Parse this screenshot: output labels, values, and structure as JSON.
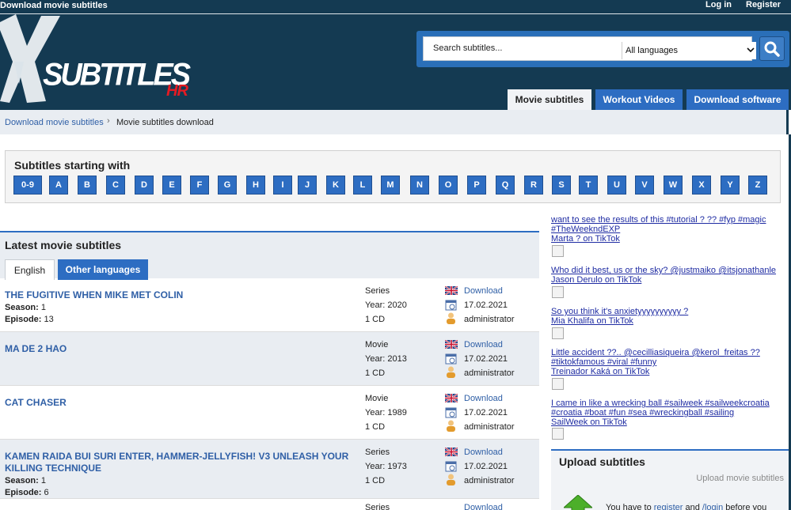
{
  "header": {
    "site_title": "Download movie subtitles",
    "login": "Log in",
    "register": "Register",
    "logo_text": "SUBTITLES",
    "logo_suffix": "HR",
    "search": {
      "placeholder": "Search subtitles...",
      "language": "All languages"
    },
    "tabs": [
      "Movie subtitles",
      "Workout Videos",
      "Download software"
    ]
  },
  "breadcrumb": {
    "link": "Download movie subtitles",
    "current": "Movie subtitles download"
  },
  "alphabet": {
    "title": "Subtitles starting with",
    "letters": [
      "0-9",
      "A",
      "B",
      "C",
      "D",
      "E",
      "F",
      "G",
      "H",
      "I",
      "J",
      "K",
      "L",
      "M",
      "N",
      "O",
      "P",
      "Q",
      "R",
      "S",
      "T",
      "U",
      "V",
      "W",
      "X",
      "Y",
      "Z"
    ]
  },
  "latest": {
    "title": "Latest movie subtitles",
    "tabs": [
      "English",
      "Other languages"
    ],
    "rows": [
      {
        "title": "THE FUGITIVE WHEN MIKE MET COLIN",
        "season": "1",
        "episode": "13",
        "type": "Series",
        "year": "Year: 2020",
        "cd": "1 CD",
        "download": "Download",
        "date": "17.02.2021",
        "user": "administrator"
      },
      {
        "title": "MA DE 2 HAO",
        "type": "Movie",
        "year": "Year: 2013",
        "cd": "1 CD",
        "download": "Download",
        "date": "17.02.2021",
        "user": "administrator"
      },
      {
        "title": "CAT CHASER",
        "type": "Movie",
        "year": "Year: 1989",
        "cd": "1 CD",
        "download": "Download",
        "date": "17.02.2021",
        "user": "administrator"
      },
      {
        "title": "KAMEN RAIDA BUI SURI ENTER, HAMMER-JELLYFISH! V3 UNLEASH YOUR KILLING TECHNIQUE",
        "season": "1",
        "episode": "6",
        "type": "Series",
        "year": "Year: 1973",
        "cd": "1 CD",
        "download": "Download",
        "date": "17.02.2021",
        "user": "administrator"
      }
    ],
    "season_label": "Season:",
    "episode_label": "Episode:",
    "partial_type": "Series",
    "partial_download": "Download"
  },
  "tiktok": [
    {
      "lines": [
        "want to see the results of this #tutorial ? ?? #fyp #magic",
        "#TheWeekndEXP",
        "Marta ? on TikTok"
      ]
    },
    {
      "lines": [
        "Who did it best, us or the sky? @justmaiko @itsjonathanle",
        "Jason Derulo on TikTok"
      ]
    },
    {
      "lines": [
        "So you think it's anxietyyyyyyyyyy ?",
        "Mia Khalifa on TikTok"
      ]
    },
    {
      "lines": [
        "Little accident ??.. @cecilliasiqueira @kerol_freitas ??",
        "#tiktokfamous #viral #funny",
        "Treinador Kaká on TikTok"
      ]
    },
    {
      "lines": [
        "I came in like a wrecking ball #sailweek #sailweekcroatia",
        "#croatia #boat #fun #sea #wreckingball #sailing",
        "SailWeek on TikTok"
      ]
    }
  ],
  "upload": {
    "title": "Upload subtitles",
    "subtitle": "Upload movie subtitles",
    "text_prefix": "You have to ",
    "register": "register",
    "and": " and ",
    "login": "/login",
    "text_suffix": " before you"
  },
  "colors": {
    "header_bg": "#143a52",
    "accent": "#2d6dc2",
    "link": "#2f5fa6"
  }
}
